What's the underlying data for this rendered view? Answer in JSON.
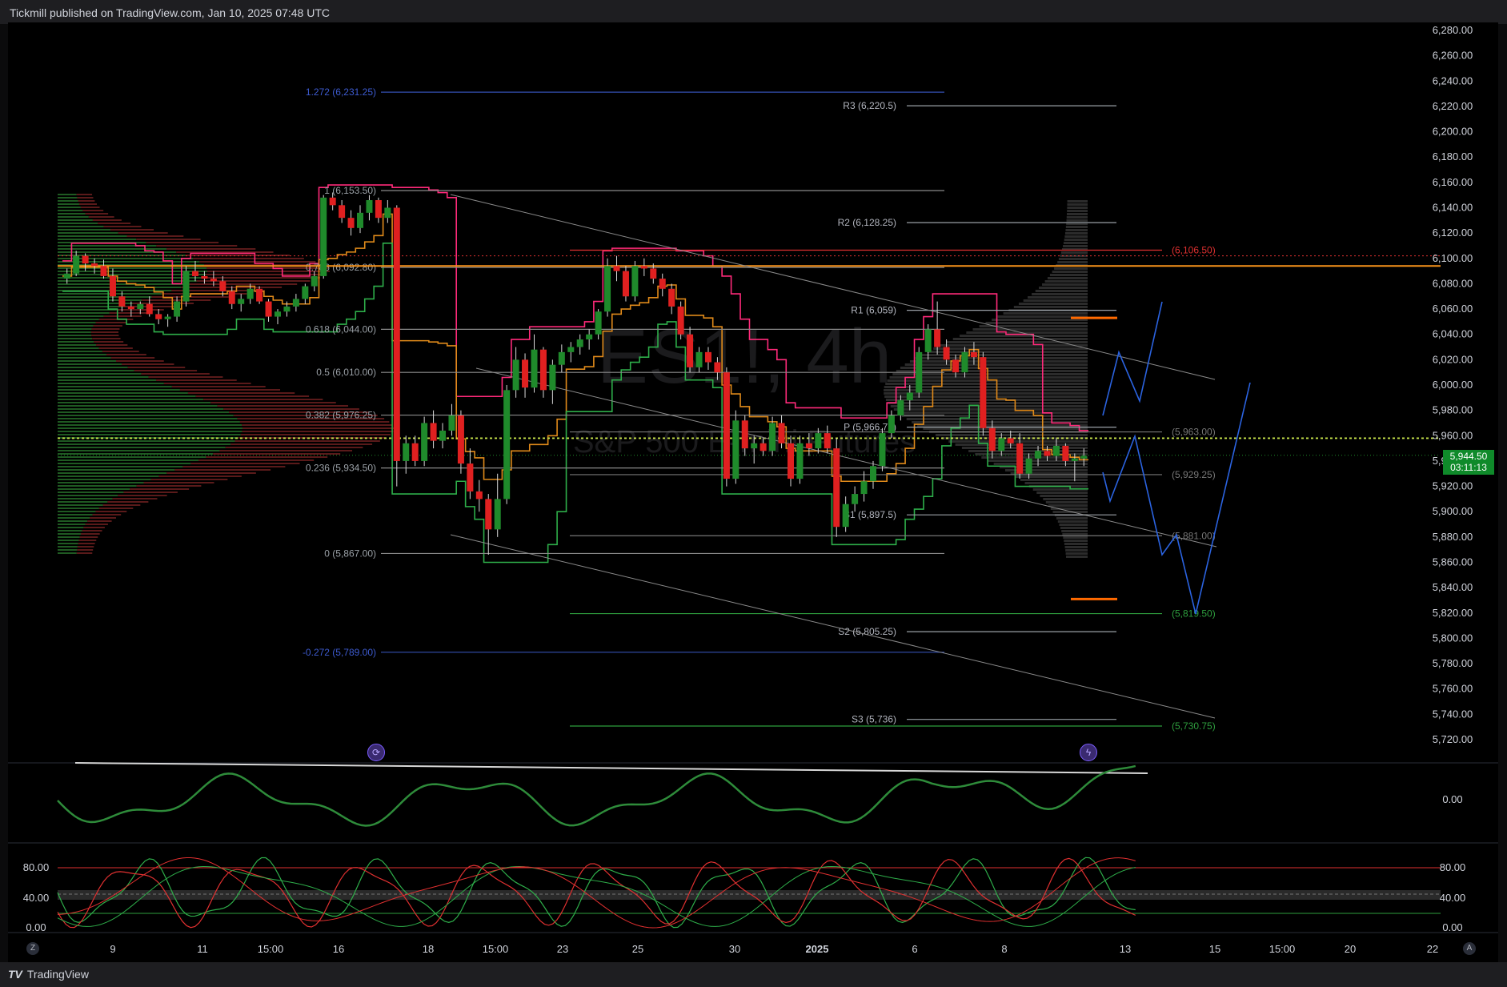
{
  "header": {
    "published_by": "Tickmill published on TradingView.com, Jan 10, 2025 07:48 UTC"
  },
  "footer": {
    "brand": "TradingView",
    "brand_glyph": "TV"
  },
  "watermark": {
    "symbol": "ES1!, 4h",
    "description": "S&P 500 E-mini Futures"
  },
  "price_tag": {
    "price": "5,944.50",
    "countdown": "03:11:13"
  },
  "icons": {
    "replay": "replay-icon",
    "alert": "lightning-icon",
    "auto_scale_left": "Z",
    "auto_scale_right": "A"
  },
  "colors": {
    "up": "#1f8a2b",
    "down": "#e02020",
    "fib": "#3451b2",
    "pivot": "#9aa0a6",
    "forecast": "#2b63e0",
    "yellow_line": "#c7e34a"
  },
  "chart_data": {
    "type": "candlestick",
    "y_axis_ticks": [
      "6,280.00",
      "6,260.00",
      "6,240.00",
      "6,220.00",
      "6,200.00",
      "6,180.00",
      "6,160.00",
      "6,140.00",
      "6,120.00",
      "6,100.00",
      "6,080.00",
      "6,060.00",
      "6,040.00",
      "6,020.00",
      "6,000.00",
      "5,980.00",
      "5,960.00",
      "5,940.00",
      "5,920.00",
      "5,900.00",
      "5,880.00",
      "5,860.00",
      "5,840.00",
      "5,820.00",
      "5,800.00",
      "5,780.00",
      "5,760.00",
      "5,740.00",
      "5,720.00"
    ],
    "ylim": [
      5712,
      6286
    ],
    "x_axis_ticks": [
      "9",
      "11",
      "15:00",
      "16",
      "18",
      "15:00",
      "23",
      "25",
      "30",
      "2025",
      "6",
      "8",
      "13",
      "15",
      "15:00",
      "20",
      "22"
    ],
    "fib_levels": [
      {
        "label": "1.272 (6,231.25)",
        "price": 6231.25
      },
      {
        "label": "1 (6,153.50)",
        "price": 6153.5
      },
      {
        "label": "0.786 (6,092.80)",
        "price": 6092.8
      },
      {
        "label": "0.618 (6,044.00)",
        "price": 6044.0
      },
      {
        "label": "0.5 (6,010.00)",
        "price": 6010.0
      },
      {
        "label": "0.382 (5,976.25)",
        "price": 5976.25
      },
      {
        "label": "0.236 (5,934.50)",
        "price": 5934.5
      },
      {
        "label": "0 (5,867.00)",
        "price": 5867.0
      },
      {
        "label": "-0.272 (5,789.00)",
        "price": 5789.0
      }
    ],
    "pivot_levels": [
      {
        "label": "R3 (6,220.5)",
        "price": 6220.5
      },
      {
        "label": "R2 (6,128.25)",
        "price": 6128.25
      },
      {
        "label": "R1 (6,059)",
        "price": 6059
      },
      {
        "label": "P (5,966.75)",
        "price": 5966.75
      },
      {
        "label": "S1 (5,897.5)",
        "price": 5897.5
      },
      {
        "label": "S2 (5,805.25)",
        "price": 5805.25
      },
      {
        "label": "S3 (5,736)",
        "price": 5736
      }
    ],
    "right_levels": [
      {
        "label": "(6,106.50)",
        "price": 6106.5,
        "color": "#e03030"
      },
      {
        "label": "(5,963.00)",
        "price": 5963.0,
        "color": "#777"
      },
      {
        "label": "(5,929.25)",
        "price": 5929.25,
        "color": "#777"
      },
      {
        "label": "(5,881.00)",
        "price": 5881.0,
        "color": "#777"
      },
      {
        "label": "(5,819.50)",
        "price": 5819.5,
        "color": "#2e9e3e"
      },
      {
        "label": "(5,730.75)",
        "price": 5730.75,
        "color": "#2e9e3e"
      }
    ],
    "candles": [
      [
        6084,
        6092,
        6080,
        6088
      ],
      [
        6088,
        6106,
        6086,
        6102
      ],
      [
        6102,
        6104,
        6090,
        6096
      ],
      [
        6096,
        6100,
        6088,
        6094
      ],
      [
        6094,
        6099,
        6084,
        6086
      ],
      [
        6086,
        6092,
        6066,
        6070
      ],
      [
        6070,
        6074,
        6058,
        6062
      ],
      [
        6062,
        6066,
        6054,
        6060
      ],
      [
        6060,
        6066,
        6056,
        6064
      ],
      [
        6064,
        6070,
        6054,
        6056
      ],
      [
        6056,
        6060,
        6048,
        6052
      ],
      [
        6052,
        6056,
        6046,
        6054
      ],
      [
        6054,
        6070,
        6050,
        6066
      ],
      [
        6066,
        6094,
        6062,
        6090
      ],
      [
        6090,
        6098,
        6082,
        6086
      ],
      [
        6086,
        6090,
        6080,
        6084
      ],
      [
        6084,
        6090,
        6078,
        6082
      ],
      [
        6082,
        6086,
        6070,
        6074
      ],
      [
        6074,
        6078,
        6060,
        6064
      ],
      [
        6064,
        6072,
        6058,
        6068
      ],
      [
        6068,
        6080,
        6064,
        6076
      ],
      [
        6076,
        6078,
        6064,
        6066
      ],
      [
        6066,
        6068,
        6050,
        6054
      ],
      [
        6054,
        6060,
        6048,
        6058
      ],
      [
        6058,
        6066,
        6054,
        6062
      ],
      [
        6062,
        6072,
        6058,
        6068
      ],
      [
        6068,
        6080,
        6064,
        6078
      ],
      [
        6078,
        6090,
        6074,
        6086
      ],
      [
        6086,
        6150,
        6084,
        6148
      ],
      [
        6148,
        6152,
        6138,
        6142
      ],
      [
        6142,
        6146,
        6128,
        6132
      ],
      [
        6132,
        6138,
        6118,
        6124
      ],
      [
        6124,
        6142,
        6120,
        6136
      ],
      [
        6136,
        6150,
        6130,
        6146
      ],
      [
        6146,
        6148,
        6128,
        6132
      ],
      [
        6132,
        6146,
        6128,
        6140
      ],
      [
        6140,
        6142,
        5920,
        5940
      ],
      [
        5940,
        5960,
        5930,
        5954
      ],
      [
        5954,
        5960,
        5936,
        5940
      ],
      [
        5940,
        5975,
        5936,
        5970
      ],
      [
        5970,
        5980,
        5950,
        5956
      ],
      [
        5956,
        5970,
        5950,
        5964
      ],
      [
        5964,
        5985,
        5960,
        5976
      ],
      [
        5976,
        5980,
        5930,
        5938
      ],
      [
        5938,
        5950,
        5910,
        5916
      ],
      [
        5916,
        5925,
        5900,
        5910
      ],
      [
        5910,
        5914,
        5866,
        5886
      ],
      [
        5886,
        5930,
        5880,
        5910
      ],
      [
        5910,
        6000,
        5906,
        5996
      ],
      [
        5996,
        6030,
        5990,
        6020
      ],
      [
        6020,
        6025,
        5990,
        5998
      ],
      [
        5998,
        6040,
        5994,
        6028
      ],
      [
        6028,
        6030,
        5990,
        5996
      ],
      [
        5996,
        6020,
        5985,
        6016
      ],
      [
        6016,
        6032,
        6010,
        6026
      ],
      [
        6026,
        6034,
        6018,
        6030
      ],
      [
        6030,
        6040,
        6024,
        6036
      ],
      [
        6036,
        6044,
        6028,
        6040
      ],
      [
        6040,
        6060,
        6036,
        6058
      ],
      [
        6058,
        6100,
        6054,
        6094
      ],
      [
        6094,
        6102,
        6082,
        6090
      ],
      [
        6090,
        6094,
        6066,
        6070
      ],
      [
        6070,
        6098,
        6066,
        6094
      ],
      [
        6094,
        6100,
        6086,
        6092
      ],
      [
        6092,
        6096,
        6080,
        6084
      ],
      [
        6084,
        6088,
        6070,
        6076
      ],
      [
        6076,
        6080,
        6056,
        6062
      ],
      [
        6062,
        6066,
        6036,
        6040
      ],
      [
        6040,
        6046,
        6010,
        6014
      ],
      [
        6014,
        6030,
        6010,
        6026
      ],
      [
        6026,
        6030,
        6012,
        6018
      ],
      [
        6018,
        6022,
        6004,
        6010
      ],
      [
        6010,
        6014,
        5920,
        5926
      ],
      [
        5926,
        5980,
        5922,
        5972
      ],
      [
        5972,
        5976,
        5944,
        5950
      ],
      [
        5950,
        5960,
        5938,
        5954
      ],
      [
        5954,
        5958,
        5944,
        5948
      ],
      [
        5948,
        5975,
        5944,
        5970
      ],
      [
        5970,
        5976,
        5950,
        5954
      ],
      [
        5954,
        5960,
        5920,
        5926
      ],
      [
        5926,
        5960,
        5922,
        5954
      ],
      [
        5954,
        5962,
        5944,
        5950
      ],
      [
        5950,
        5966,
        5946,
        5962
      ],
      [
        5962,
        5968,
        5946,
        5950
      ],
      [
        5950,
        5958,
        5880,
        5888
      ],
      [
        5888,
        5912,
        5884,
        5906
      ],
      [
        5906,
        5920,
        5900,
        5914
      ],
      [
        5914,
        5932,
        5908,
        5924
      ],
      [
        5924,
        5940,
        5918,
        5936
      ],
      [
        5936,
        5966,
        5932,
        5962
      ],
      [
        5962,
        5980,
        5958,
        5976
      ],
      [
        5976,
        5992,
        5972,
        5988
      ],
      [
        5988,
        6000,
        5980,
        5994
      ],
      [
        5994,
        6030,
        5990,
        6026
      ],
      [
        6026,
        6048,
        6020,
        6044
      ],
      [
        6044,
        6066,
        6024,
        6030
      ],
      [
        6030,
        6036,
        6016,
        6020
      ],
      [
        6020,
        6024,
        6006,
        6010
      ],
      [
        6010,
        6030,
        6006,
        6026
      ],
      [
        6026,
        6034,
        6016,
        6022
      ],
      [
        6022,
        6026,
        5960,
        5966
      ],
      [
        5966,
        5972,
        5942,
        5948
      ],
      [
        5948,
        5962,
        5944,
        5958
      ],
      [
        5958,
        5964,
        5950,
        5954
      ],
      [
        5954,
        5962,
        5926,
        5930
      ],
      [
        5930,
        5946,
        5926,
        5942
      ],
      [
        5942,
        5952,
        5936,
        5948
      ],
      [
        5948,
        5952,
        5940,
        5944
      ],
      [
        5944,
        5958,
        5940,
        5952
      ],
      [
        5952,
        5954,
        5936,
        5940
      ],
      [
        5940,
        5946,
        5924,
        5942
      ],
      [
        5942,
        5950,
        5936,
        5944
      ]
    ],
    "forecast_paths": [
      [
        [
          1378,
          519
        ],
        [
          1398,
          440
        ],
        [
          1424,
          501
        ],
        [
          1452,
          377
        ]
      ],
      [
        [
          1378,
          590
        ],
        [
          1387,
          626
        ],
        [
          1418,
          545
        ],
        [
          1452,
          693
        ],
        [
          1470,
          668
        ],
        [
          1494,
          767
        ],
        [
          1562,
          478
        ]
      ]
    ],
    "macd_ticks": [
      "0.00"
    ],
    "stoch_ticks": [
      "80.00",
      "40.00",
      "0.00"
    ]
  }
}
